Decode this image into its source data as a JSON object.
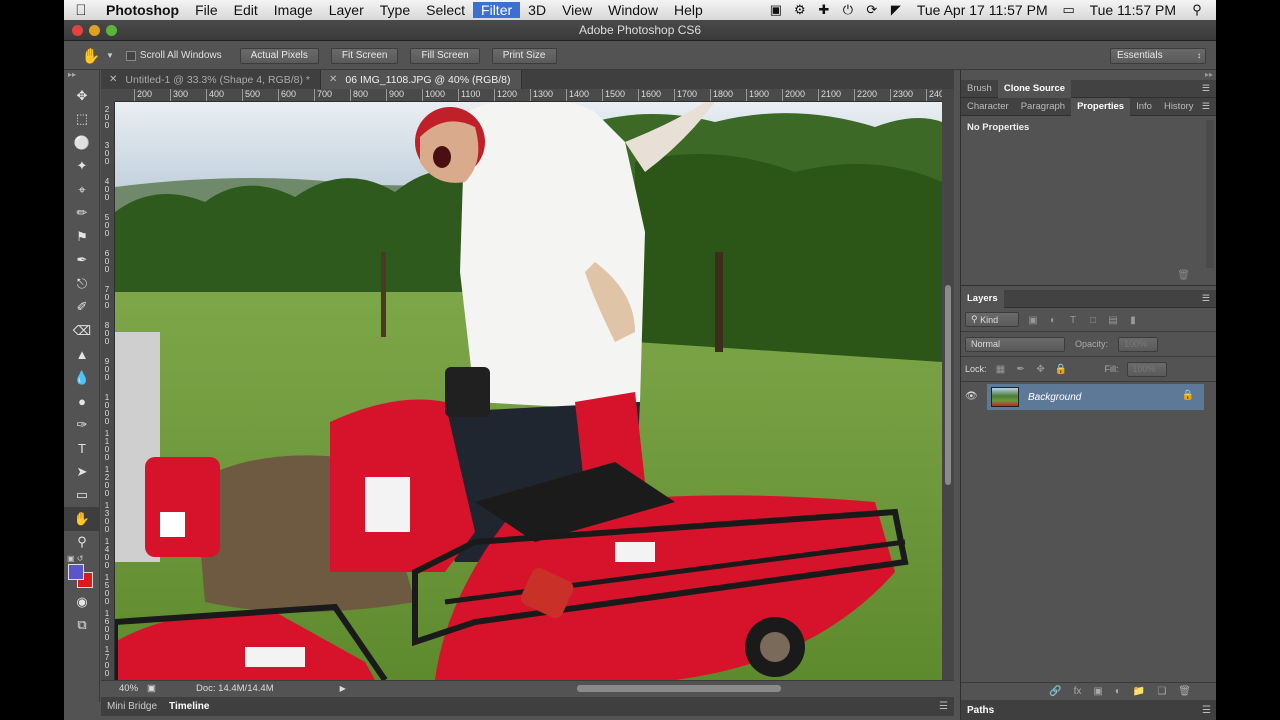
{
  "menubar": {
    "app": "Photoshop",
    "items": [
      "File",
      "Edit",
      "Image",
      "Layer",
      "Type",
      "Select",
      "Filter",
      "3D",
      "View",
      "Window",
      "Help"
    ],
    "active_item": "Filter",
    "date_short": "Tue Apr 17  11:57 PM",
    "clock": "Tue 11:57 PM"
  },
  "window": {
    "title": "Adobe Photoshop CS6"
  },
  "options": {
    "scroll_all": "Scroll All Windows",
    "buttons": [
      "Actual Pixels",
      "Fit Screen",
      "Fill Screen",
      "Print Size"
    ],
    "workspace": "Essentials"
  },
  "doc_tabs": [
    {
      "label": "Untitled-1 @ 33.3% (Shape 4, RGB/8) *",
      "active": false
    },
    {
      "label": "06 IMG_1108.JPG @ 40% (RGB/8)",
      "active": true
    }
  ],
  "ruler": {
    "top": [
      "200",
      "300",
      "400",
      "500",
      "600",
      "700",
      "800",
      "900",
      "1000",
      "1100",
      "1200",
      "1300",
      "1400",
      "1500",
      "1600",
      "1700",
      "1800",
      "1900",
      "2000",
      "2100",
      "2200",
      "2300",
      "240"
    ],
    "left": [
      "200",
      "300",
      "400",
      "500",
      "600",
      "700",
      "800",
      "900",
      "1000",
      "1100",
      "1200",
      "1300",
      "1400",
      "1500",
      "1600",
      "1700"
    ]
  },
  "status": {
    "zoom": "40%",
    "doc": "Doc: 14.4M/14.4M"
  },
  "bottom_tabs": [
    "Mini Bridge",
    "Timeline"
  ],
  "panels": {
    "top_tabs": [
      "Brush",
      "Clone Source"
    ],
    "mid_tabs": [
      "Character",
      "Paragraph",
      "Properties",
      "Info",
      "History"
    ],
    "properties_text": "No Properties",
    "layers_title": "Layers",
    "filter_kind": "Kind",
    "blend_mode": "Normal",
    "opacity_label": "Opacity:",
    "opacity_value": "100%",
    "lock_label": "Lock:",
    "fill_label": "Fill:",
    "fill_value": "100%",
    "layer_name": "Background",
    "paths_tab": "Paths"
  },
  "colors": {
    "foreground": "#5b55cc",
    "background": "#e01818",
    "selection": "#5e7898"
  }
}
